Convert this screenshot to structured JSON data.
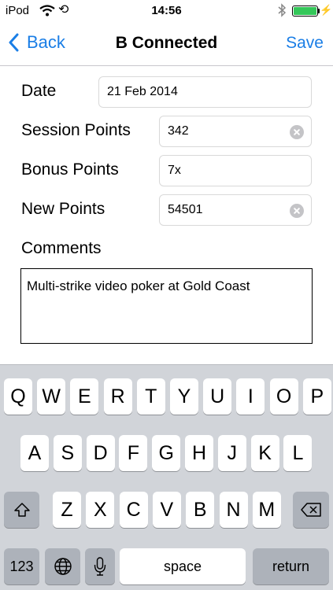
{
  "status_bar": {
    "carrier": "iPod",
    "time": "14:56",
    "battery_level": 1.0,
    "battery_color": "#34c759"
  },
  "nav": {
    "back_label": "Back",
    "title": "B Connected",
    "save_label": "Save"
  },
  "form": {
    "date": {
      "label": "Date",
      "value": "21 Feb 2014"
    },
    "session_points": {
      "label": "Session Points",
      "value": "342"
    },
    "bonus_points": {
      "label": "Bonus Points",
      "value": "7x"
    },
    "new_points": {
      "label": "New Points",
      "value": "54501"
    },
    "comments": {
      "label": "Comments",
      "value": "Multi-strike video poker at Gold Coast"
    }
  },
  "keyboard": {
    "row1": [
      "Q",
      "W",
      "E",
      "R",
      "T",
      "Y",
      "U",
      "I",
      "O",
      "P"
    ],
    "row2": [
      "A",
      "S",
      "D",
      "F",
      "G",
      "H",
      "J",
      "K",
      "L"
    ],
    "row3": [
      "Z",
      "X",
      "C",
      "V",
      "B",
      "N",
      "M"
    ],
    "numbers_label": "123",
    "space_label": "space",
    "return_label": "return"
  },
  "colors": {
    "accent": "#1a7ee6",
    "keyboard_bg": "#d1d4d9",
    "special_key": "#adb2ba"
  }
}
